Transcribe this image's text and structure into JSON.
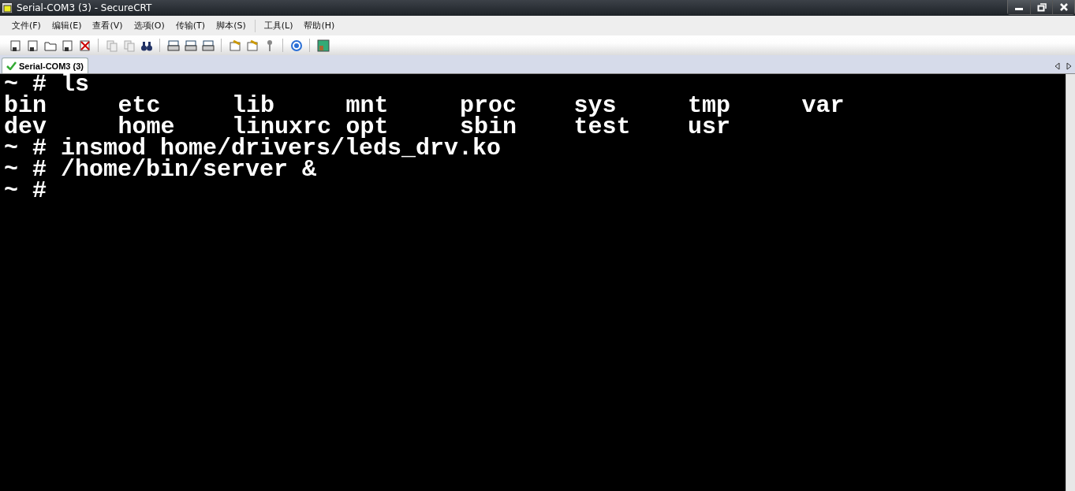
{
  "window": {
    "title": "Serial-COM3 (3) - SecureCRT"
  },
  "menu_groups": [
    [
      "文件(F)",
      "编辑(E)",
      "查看(V)",
      "选项(O)",
      "传输(T)",
      "脚本(S)"
    ],
    [
      "工具(L)",
      "帮助(H)"
    ]
  ],
  "tabs": [
    {
      "label": "Serial-COM3 (3)",
      "selected": true,
      "connected": true
    }
  ],
  "terminal": {
    "lines": [
      {
        "kind": "text",
        "text": "~ # ls"
      },
      {
        "kind": "columns",
        "cells": [
          "bin",
          "etc",
          "lib",
          "mnt",
          "proc",
          "sys",
          "tmp",
          "var"
        ]
      },
      {
        "kind": "columns",
        "cells": [
          "dev",
          "home",
          "linuxrc",
          "opt",
          "sbin",
          "test",
          "usr"
        ]
      },
      {
        "kind": "text",
        "text": "~ # insmod home/drivers/leds_drv.ko"
      },
      {
        "kind": "text",
        "text": "~ # /home/bin/server &"
      },
      {
        "kind": "text",
        "text": "~ #"
      }
    ]
  }
}
